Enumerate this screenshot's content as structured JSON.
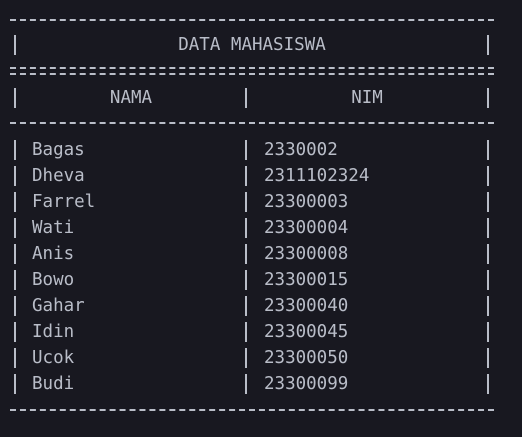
{
  "table": {
    "title": "DATA MAHASISWA",
    "headers": {
      "nama": "NAMA",
      "nim": "NIM"
    },
    "rows": [
      {
        "nama": "Bagas",
        "nim": "2330002"
      },
      {
        "nama": "Dheva",
        "nim": "2311102324"
      },
      {
        "nama": "Farrel",
        "nim": "23300003"
      },
      {
        "nama": "Wati",
        "nim": "23300004"
      },
      {
        "nama": "Anis",
        "nim": "23300008"
      },
      {
        "nama": "Bowo",
        "nim": "23300015"
      },
      {
        "nama": "Gahar",
        "nim": "23300040"
      },
      {
        "nama": "Idin",
        "nim": "23300045"
      },
      {
        "nama": "Ucok",
        "nim": "23300050"
      },
      {
        "nama": "Budi",
        "nim": "23300099"
      }
    ]
  },
  "colors": {
    "background": "#181820",
    "text": "#b9bdc8"
  }
}
